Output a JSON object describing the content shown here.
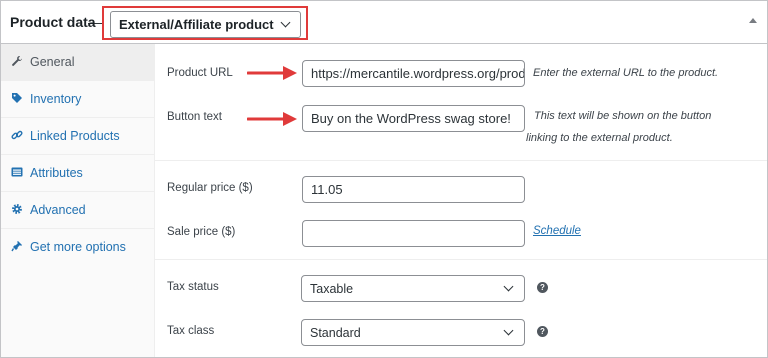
{
  "header": {
    "title": "Product data",
    "dash": "—",
    "product_type": "External/Affiliate product"
  },
  "tabs": [
    {
      "label": "General",
      "icon": "wrench-icon"
    },
    {
      "label": "Inventory",
      "icon": "tag-icon"
    },
    {
      "label": "Linked Products",
      "icon": "link-icon"
    },
    {
      "label": "Attributes",
      "icon": "list-icon"
    },
    {
      "label": "Advanced",
      "icon": "gear-icon"
    },
    {
      "label": "Get more options",
      "icon": "plugin-icon"
    }
  ],
  "fields": {
    "product_url": {
      "label": "Product URL",
      "value": "https://mercantile.wordpress.org/product",
      "description": "Enter the external URL to the product."
    },
    "button_text": {
      "label": "Button text",
      "value": "Buy on the WordPress swag store!",
      "description_line1": "This text will be shown on the button",
      "description_line2": "linking to the external product."
    },
    "regular_price": {
      "label": "Regular price ($)",
      "value": "11.05"
    },
    "sale_price": {
      "label": "Sale price ($)",
      "value": "",
      "link": "Schedule"
    },
    "tax_status": {
      "label": "Tax status",
      "value": "Taxable"
    },
    "tax_class": {
      "label": "Tax class",
      "value": "Standard"
    }
  },
  "colors": {
    "highlight": "#e03a3a",
    "link": "#2271b1"
  }
}
